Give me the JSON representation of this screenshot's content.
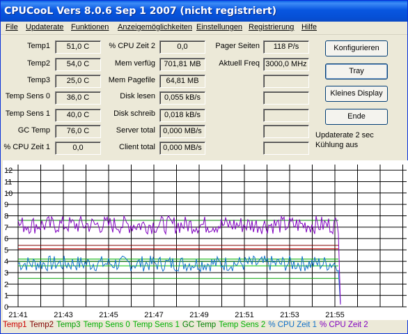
{
  "window": {
    "title": "CPUCooL  Vers 8.0.6  Sep  1 2007 (nicht registriert)"
  },
  "menu": [
    "File",
    "Updaterate",
    "Funktionen",
    "Anzeigemöglichkeiten",
    "Einstellungen",
    "Registrierung",
    "Hilfe"
  ],
  "col1": [
    {
      "label": "Temp1",
      "value": "51,0 C"
    },
    {
      "label": "Temp2",
      "value": "54,0 C"
    },
    {
      "label": "Temp3",
      "value": "25,0 C"
    },
    {
      "label": "Temp Sens 0",
      "value": "36,0 C"
    },
    {
      "label": "Temp Sens 1",
      "value": "40,0 C"
    },
    {
      "label": "GC Temp",
      "value": "76,0 C"
    },
    {
      "label": "% CPU Zeit 1",
      "value": "0,0"
    }
  ],
  "col2": [
    {
      "label": "% CPU Zeit 2",
      "value": "0,0"
    },
    {
      "label": "Mem verfüg",
      "value": "701,81 MB"
    },
    {
      "label": "Mem Pagefile",
      "value": "64,81 MB"
    },
    {
      "label": "Disk lesen",
      "value": "0,055 kB/s"
    },
    {
      "label": "Disk schreib",
      "value": "0,018 kB/s"
    },
    {
      "label": "Server total",
      "value": "0,000 MB/s"
    },
    {
      "label": "Client total",
      "value": "0,000 MB/s"
    }
  ],
  "col3": [
    {
      "label": "Pager Seiten",
      "value": "118 P/s"
    },
    {
      "label": "Aktuell Freq",
      "value": "3000,0 MHz"
    },
    {
      "label": "",
      "value": ""
    },
    {
      "label": "",
      "value": ""
    },
    {
      "label": "",
      "value": ""
    },
    {
      "label": "",
      "value": ""
    },
    {
      "label": "",
      "value": ""
    }
  ],
  "buttons": {
    "configure": "Konfigurieren",
    "tray": "Tray",
    "small": "Kleines Display",
    "end": "Ende"
  },
  "status": {
    "rate": "Updaterate 2 sec",
    "cooling": "Kühlung aus"
  },
  "chart_data": {
    "type": "line",
    "yticks": [
      "12",
      "11",
      "10",
      "9",
      "8",
      "7",
      "6",
      "5",
      "4",
      "3",
      "2",
      "1",
      "0"
    ],
    "ylim": [
      0,
      12.5
    ],
    "xticks": [
      "21:41",
      "21:43",
      "21:45",
      "21:47",
      "21:49",
      "21:51",
      "21:53",
      "21:55"
    ],
    "series": [
      {
        "name": "Temp1",
        "color": "#cc0000",
        "value": 5.1
      },
      {
        "name": "Temp2",
        "color": "#800000",
        "value": 5.4
      },
      {
        "name": "Temp3",
        "color": "#00a000",
        "value": 2.5
      },
      {
        "name": "Temp Sens 0",
        "color": "#00c000",
        "value": 3.6
      },
      {
        "name": "Temp Sens 1",
        "color": "#008000",
        "value": 4.0
      },
      {
        "name": "GC Temp",
        "color": "#008000",
        "value": 7.6
      },
      {
        "name": "Temp Sens 2",
        "color": "#00b000",
        "value": 4.2
      },
      {
        "name": "% CPU Zeit 1",
        "color": "#1070c8",
        "value": 3.8
      },
      {
        "name": "% CPU Zeit 2",
        "color": "#8000c0",
        "value": 7.2
      }
    ]
  },
  "legend": [
    {
      "text": "Temp1",
      "color": "#cc0000"
    },
    {
      "text": "Temp2",
      "color": "#800000"
    },
    {
      "text": "Temp3",
      "color": "#00a000"
    },
    {
      "text": "Temp Sens 0",
      "color": "#00b000"
    },
    {
      "text": "Temp Sens 1",
      "color": "#00b000"
    },
    {
      "text": "GC Temp",
      "color": "#008000"
    },
    {
      "text": "Temp Sens 2",
      "color": "#00b000"
    },
    {
      "text": "% CPU Zeit 1",
      "color": "#1070c8"
    },
    {
      "text": "% CPU Zeit 2",
      "color": "#8000c0"
    }
  ]
}
